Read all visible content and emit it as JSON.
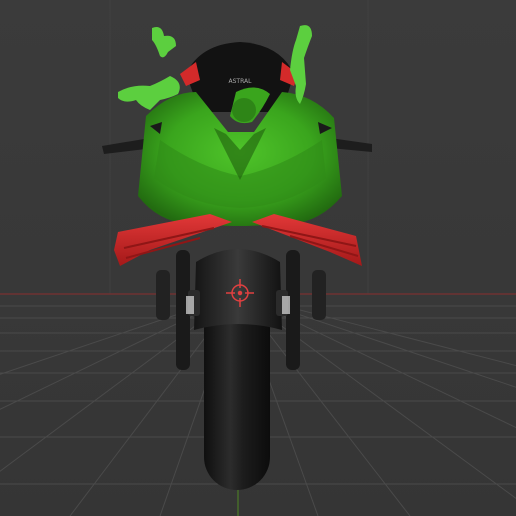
{
  "viewport": {
    "background": "#393939",
    "grid_color": "#4a4a4a",
    "x_axis_color": "#7a3030",
    "y_axis_color": "#4b7a26"
  },
  "model": {
    "body_color": "#3fae1f",
    "body_dark": "#2b7d14",
    "wing_color": "#d42a2a",
    "wing_dark": "#8f1616",
    "tire_color": "#1b1b1b",
    "windshield_color": "#111111",
    "drip_color": "#63d94a"
  },
  "windshield_logo": "ASTRAL",
  "icons": [
    "object-origin-crosshair-icon"
  ]
}
